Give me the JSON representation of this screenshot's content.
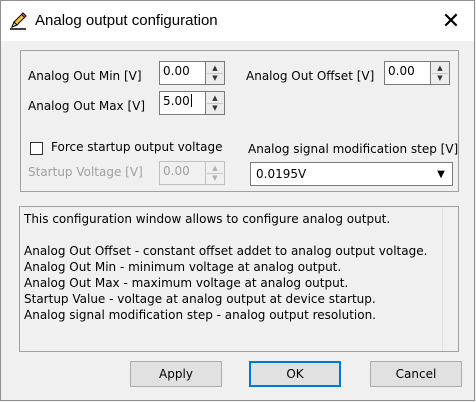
{
  "window": {
    "title": "Analog output configuration",
    "close_icon": "close-x-icon",
    "app_icon": "pencil-icon"
  },
  "settings": {
    "out_min": {
      "label": "Analog Out Min [V]",
      "value": "0.00"
    },
    "out_max": {
      "label": "Analog Out Max [V]",
      "value": "5.00"
    },
    "out_offset": {
      "label": "Analog Out Offset [V]",
      "value": "0.00"
    },
    "force_startup": {
      "label": "Force startup output voltage",
      "checked": false
    },
    "startup_voltage": {
      "label": "Startup Voltage [V]",
      "value": "0.00",
      "disabled": true
    },
    "mod_step": {
      "label": "Analog signal modification step [V]",
      "value": "0.0195V"
    }
  },
  "info_text": "This configuration window allows to configure analog output.\n\nAnalog Out Offset - constant offset addet to analog output voltage.\nAnalog Out Min - minimum voltage at analog output.\nAnalog Out Max - maximum voltage at analog output.\nStartup Value - voltage at analog output at device startup.\nAnalog signal modification step - analog output resolution.",
  "buttons": {
    "apply": "Apply",
    "ok": "OK",
    "cancel": "Cancel"
  }
}
